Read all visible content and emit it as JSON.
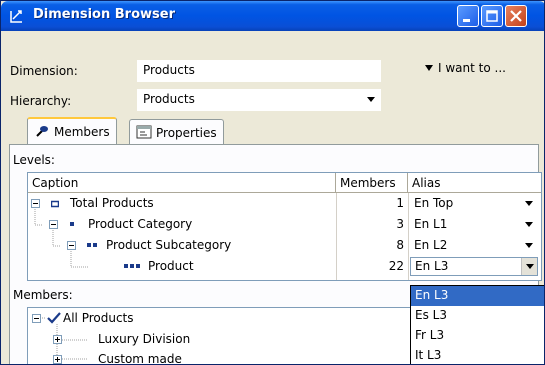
{
  "window": {
    "title": "Dimension Browser",
    "title_icon": "dimension-browser-icon"
  },
  "form": {
    "dimension_label": "Dimension:",
    "dimension_value": "Products",
    "hierarchy_label": "Hierarchy:",
    "hierarchy_value": "Products",
    "i_want_to": "I want to ..."
  },
  "tabs": [
    {
      "label": "Members",
      "icon": "members-icon",
      "active": true
    },
    {
      "label": "Properties",
      "icon": "properties-icon",
      "active": false
    }
  ],
  "levels": {
    "label": "Levels:",
    "columns": [
      "Caption",
      "Members",
      "Alias"
    ],
    "rows": [
      {
        "caption": "Total Products",
        "members": "1",
        "alias": "En Top"
      },
      {
        "caption": "Product Category",
        "members": "3",
        "alias": "En L1"
      },
      {
        "caption": "Product Subcategory",
        "members": "8",
        "alias": "En L2"
      },
      {
        "caption": "Product",
        "members": "22",
        "alias": "En L3"
      }
    ]
  },
  "members": {
    "label": "Members:",
    "items": [
      {
        "label": "All Products",
        "checked": true
      },
      {
        "label": "Luxury Division"
      },
      {
        "label": "Custom made"
      }
    ]
  },
  "alias_dropdown": {
    "options": [
      "En L3",
      "Es L3",
      "Fr L3",
      "It L3"
    ],
    "selected": "En L3"
  },
  "colors": {
    "title_bar": "#0054e3",
    "selection": "#316ac5",
    "tab_accent": "#ffc83c"
  }
}
